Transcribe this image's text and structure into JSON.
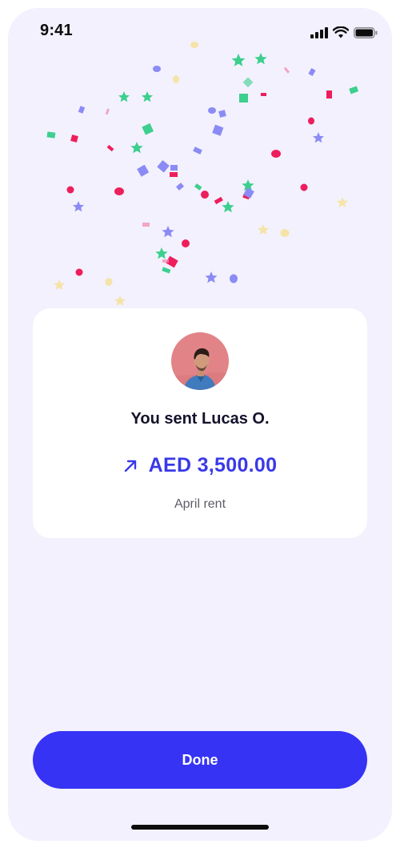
{
  "status_bar": {
    "time": "9:41"
  },
  "icons": {
    "signal": "cellular-signal-icon",
    "wifi": "wifi-icon",
    "battery": "battery-icon",
    "arrow": "arrow-up-right-icon",
    "confetti": "confetti-illustration"
  },
  "recipient": {
    "avatar": "recipient-avatar-photo"
  },
  "confirmation": {
    "title": "You sent Lucas O.",
    "amount": "AED 3,500.00",
    "note": "April rent"
  },
  "actions": {
    "done_label": "Done"
  },
  "colors": {
    "background": "#f2f1fd",
    "card": "#ffffff",
    "accent": "#3633f5",
    "amount": "#3a39e8",
    "title": "#14122b",
    "note": "#5d5d66",
    "confetti_pink": "#ee1e5c",
    "confetti_green": "#3ccf8e",
    "confetti_purple": "#8b8bf5",
    "confetti_yellow": "#f6e3a8"
  }
}
